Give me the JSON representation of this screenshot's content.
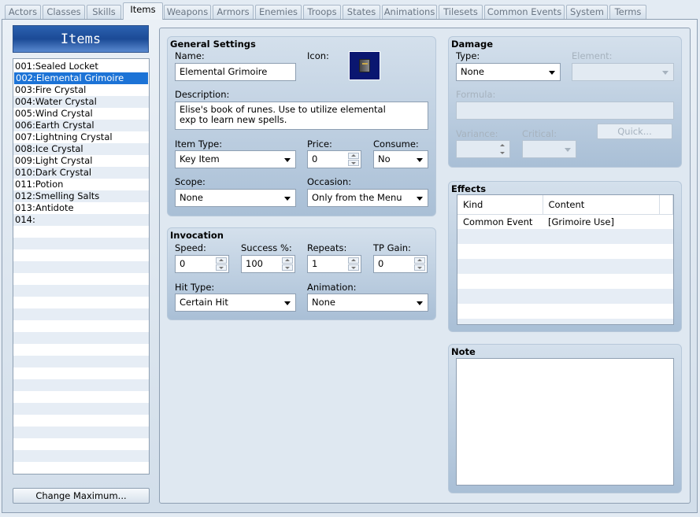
{
  "tabs": [
    "Actors",
    "Classes",
    "Skills",
    "Items",
    "Weapons",
    "Armors",
    "Enemies",
    "Troops",
    "States",
    "Animations",
    "Tilesets",
    "Common Events",
    "System",
    "Terms"
  ],
  "active_tab": "Items",
  "list": {
    "title": "Items",
    "items": [
      "001:Sealed Locket",
      "002:Elemental Grimoire",
      "003:Fire Crystal",
      "004:Water Crystal",
      "005:Wind Crystal",
      "006:Earth Crystal",
      "007:Lightning Crystal",
      "008:Ice Crystal",
      "009:Light Crystal",
      "010:Dark Crystal",
      "011:Potion",
      "012:Smelling Salts",
      "013:Antidote",
      "014:"
    ],
    "selected": 1,
    "change_max_label": "Change Maximum..."
  },
  "general": {
    "title": "General Settings",
    "name_label": "Name:",
    "name": "Elemental Grimoire",
    "icon_label": "Icon:",
    "icon": "book-icon",
    "desc_label": "Description:",
    "desc_line1": "Elise's book of runes.  Use to utilize elemental",
    "desc_line2": "exp to learn new spells.",
    "item_type_label": "Item Type:",
    "item_type": "Key Item",
    "price_label": "Price:",
    "price": "0",
    "consume_label": "Consume:",
    "consume": "No",
    "scope_label": "Scope:",
    "scope": "None",
    "occasion_label": "Occasion:",
    "occasion": "Only from the Menu"
  },
  "invocation": {
    "title": "Invocation",
    "speed_label": "Speed:",
    "speed": "0",
    "success_label": "Success %:",
    "success": "100",
    "repeats_label": "Repeats:",
    "repeats": "1",
    "tp_label": "TP Gain:",
    "tp": "0",
    "hit_type_label": "Hit Type:",
    "hit_type": "Certain Hit",
    "animation_label": "Animation:",
    "animation": "None"
  },
  "damage": {
    "title": "Damage",
    "type_label": "Type:",
    "type": "None",
    "element_label": "Element:",
    "formula_label": "Formula:",
    "variance_label": "Variance:",
    "critical_label": "Critical:",
    "quick_label": "Quick..."
  },
  "effects": {
    "title": "Effects",
    "headers": [
      "Kind",
      "Content"
    ],
    "rows": [
      {
        "kind": "Common Event",
        "content": "[Grimoire Use]"
      }
    ]
  },
  "note": {
    "title": "Note",
    "text": ""
  }
}
